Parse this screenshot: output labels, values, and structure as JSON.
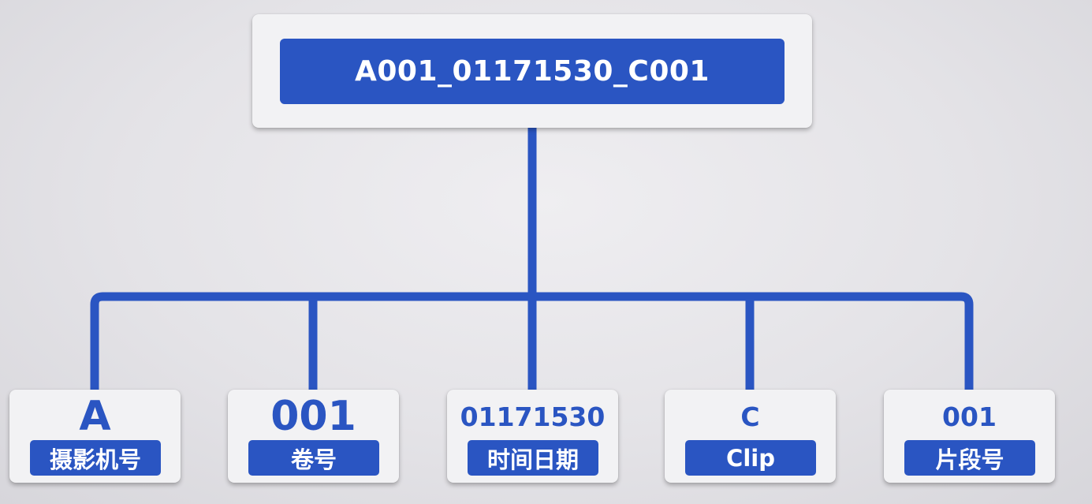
{
  "root": {
    "label": "A001_01171530_C001"
  },
  "parts": [
    {
      "code": "A",
      "label": "摄影机号"
    },
    {
      "code": "001",
      "label": "卷号"
    },
    {
      "code": "01171530",
      "label": "时间日期"
    },
    {
      "code": "C",
      "label": "Clip"
    },
    {
      "code": "001",
      "label": "片段号"
    }
  ],
  "colors": {
    "accent": "#2a55c2",
    "card": "#f2f2f4",
    "background": "#e4e3e7"
  }
}
